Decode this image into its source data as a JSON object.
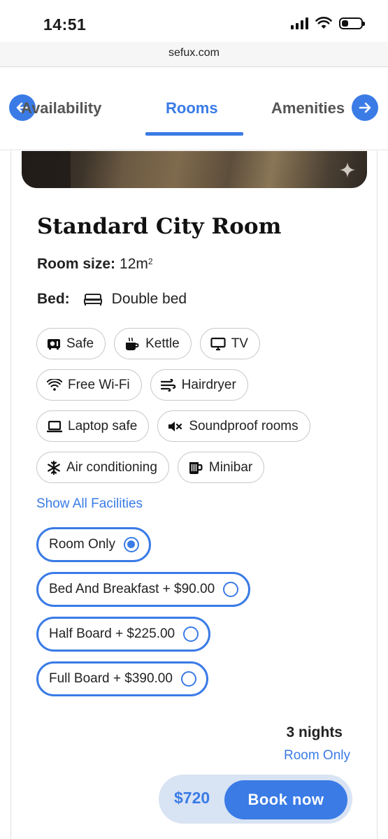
{
  "status_bar": {
    "time": "14:51",
    "battery_level": 0.35
  },
  "browser": {
    "url": "sefux.com"
  },
  "tabs": {
    "items": [
      {
        "label": "Availability",
        "active": false
      },
      {
        "label": "Rooms",
        "active": true
      },
      {
        "label": "Amenities",
        "active": false
      }
    ],
    "prev_icon": "arrow-left-icon",
    "next_icon": "arrow-right-icon"
  },
  "room": {
    "title": "Standard City Room",
    "size_label": "Room size:",
    "size_value": "12m",
    "size_sup": "2",
    "bed_label": "Bed:",
    "bed_value": "Double bed"
  },
  "facilities": {
    "items": [
      {
        "label": "Safe",
        "icon": "safe-icon"
      },
      {
        "label": "Kettle",
        "icon": "kettle-icon"
      },
      {
        "label": "TV",
        "icon": "tv-icon"
      },
      {
        "label": "Free Wi-Fi",
        "icon": "wifi-icon"
      },
      {
        "label": "Hairdryer",
        "icon": "hairdryer-icon"
      },
      {
        "label": "Laptop safe",
        "icon": "laptop-icon"
      },
      {
        "label": "Soundproof rooms",
        "icon": "mute-icon"
      },
      {
        "label": "Air conditioning",
        "icon": "snowflake-icon"
      },
      {
        "label": "Minibar",
        "icon": "minibar-icon"
      }
    ],
    "show_all": "Show All Facilities"
  },
  "board_options": [
    {
      "label": "Room Only",
      "selected": true
    },
    {
      "label": "Bed And Breakfast + $90.00",
      "selected": false
    },
    {
      "label": "Half Board + $225.00",
      "selected": false
    },
    {
      "label": "Full Board + $390.00",
      "selected": false
    }
  ],
  "summary": {
    "nights": "3 nights",
    "plan": "Room Only",
    "price": "$720",
    "book_label": "Book now"
  },
  "colors": {
    "accent": "#3a7be6",
    "book_bar_bg": "#d8e3f3"
  }
}
